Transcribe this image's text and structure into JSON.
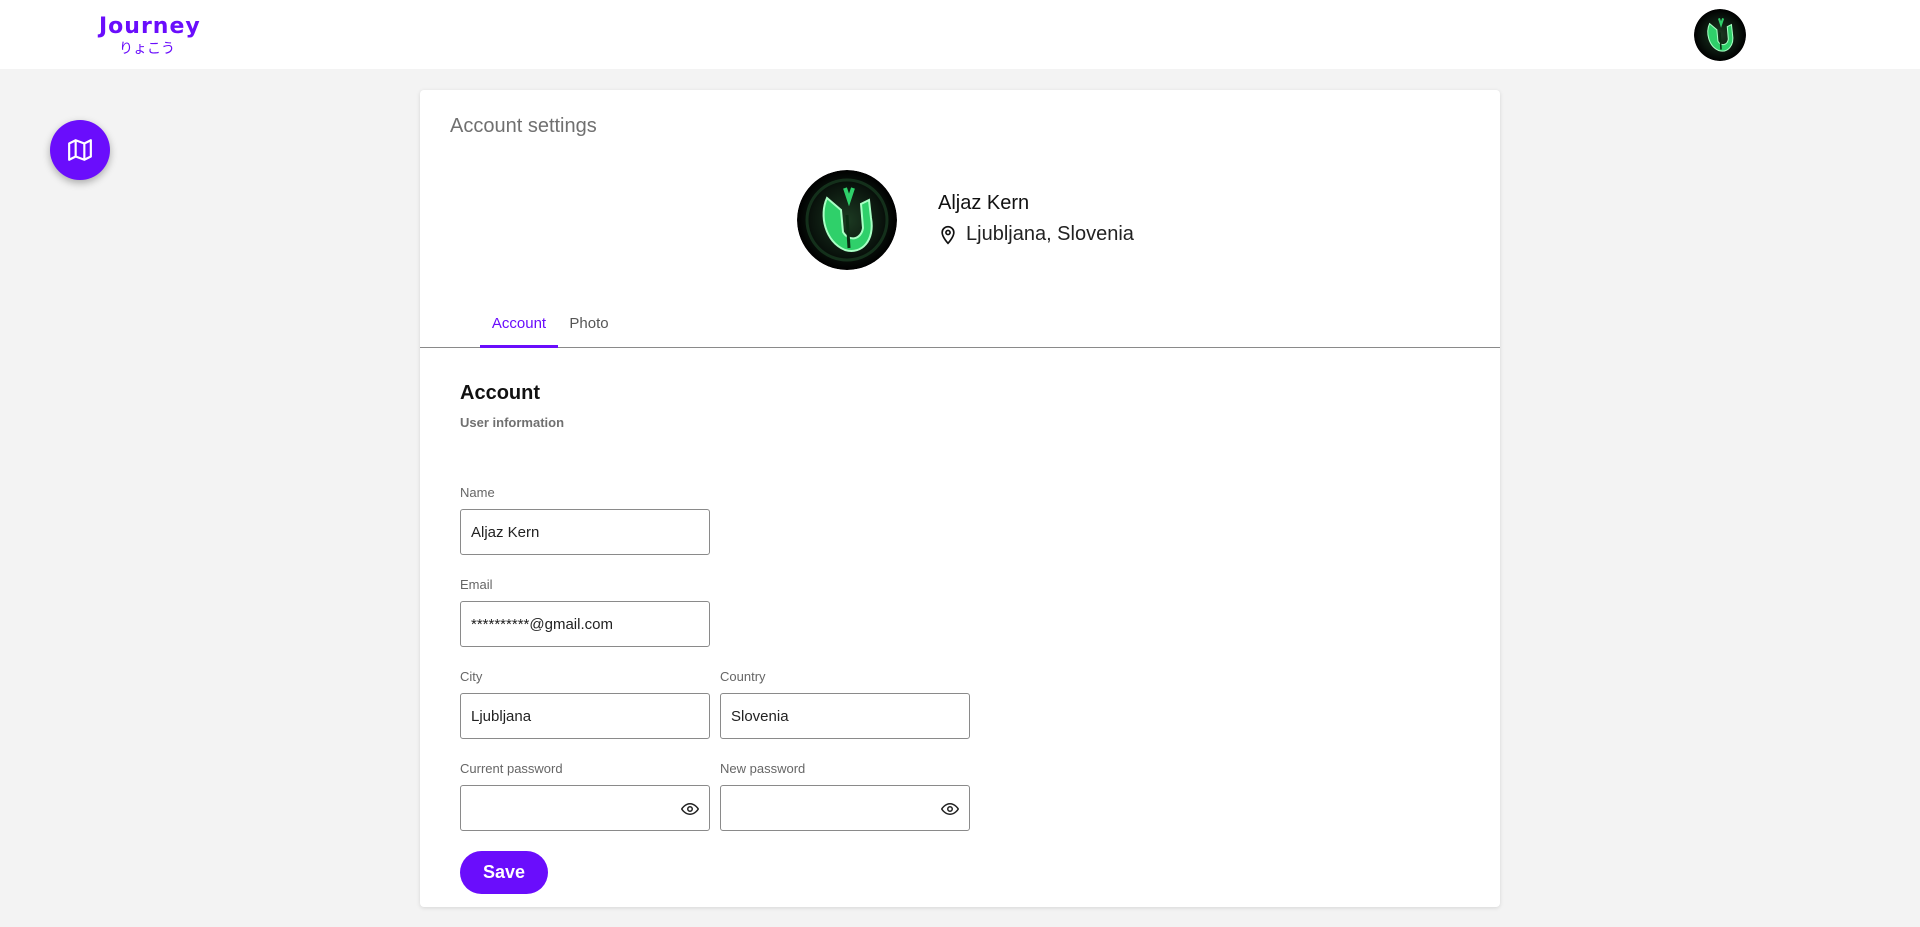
{
  "header": {
    "logo_title": "Journey",
    "logo_subtitle": "りょこう",
    "avatar_icon": "user-avatar"
  },
  "fab": {
    "icon": "map-icon"
  },
  "card": {
    "title": "Account settings",
    "profile": {
      "name": "Aljaz Kern",
      "location": "Ljubljana, Slovenia",
      "location_icon": "map-pin-icon"
    },
    "tabs": [
      {
        "label": "Account",
        "active": true
      },
      {
        "label": "Photo",
        "active": false
      }
    ],
    "section": {
      "title": "Account",
      "subtitle": "User information"
    },
    "form": {
      "name": {
        "label": "Name",
        "value": "Aljaz Kern"
      },
      "email": {
        "label": "Email",
        "value": "**********@gmail.com"
      },
      "city": {
        "label": "City",
        "value": "Ljubljana"
      },
      "country": {
        "label": "Country",
        "value": "Slovenia"
      },
      "current_password": {
        "label": "Current password",
        "value": ""
      },
      "new_password": {
        "label": "New password",
        "value": ""
      }
    },
    "save_label": "Save"
  },
  "colors": {
    "accent": "#6a0dfc",
    "background": "#f3f3f3"
  }
}
